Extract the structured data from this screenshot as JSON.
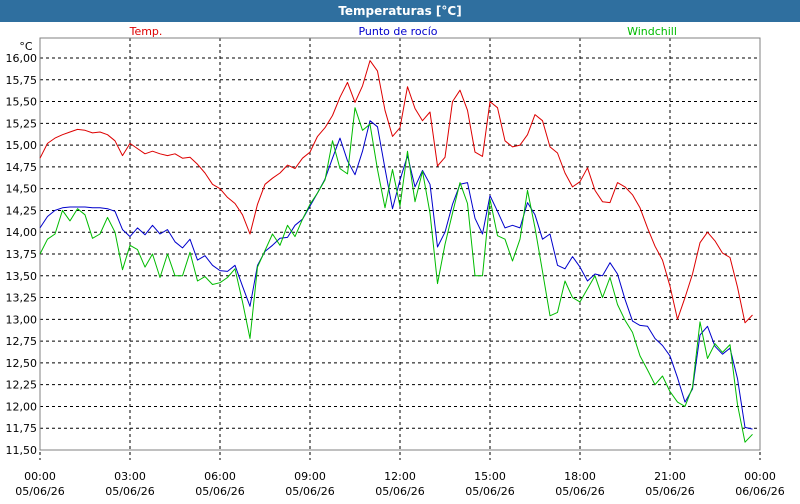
{
  "window": {
    "title": "Temperaturas [°C]"
  },
  "colors": {
    "temp": "#dd0000",
    "dew": "#0000cc",
    "wind": "#00bb00",
    "title_bg": "#2f6f9f",
    "grid": "#000000"
  },
  "chart_data": {
    "type": "line",
    "title": "Temperaturas [°C]",
    "ylabel": "°C",
    "ylim": [
      11.5,
      16.0
    ],
    "y_ticks": [
      "16,00",
      "15,75",
      "15,50",
      "15,25",
      "15,00",
      "14,75",
      "14,50",
      "14,25",
      "14,00",
      "13,75",
      "13,50",
      "13,25",
      "13,00",
      "12,75",
      "12,50",
      "12,25",
      "12,00",
      "11,75",
      "11,50"
    ],
    "y_tick_values": [
      16.0,
      15.75,
      15.5,
      15.25,
      15.0,
      14.75,
      14.5,
      14.25,
      14.0,
      13.75,
      13.5,
      13.25,
      13.0,
      12.75,
      12.5,
      12.25,
      12.0,
      11.75,
      11.5
    ],
    "x_ticks": [
      {
        "time": "00:00",
        "date": "05/06/26",
        "hour": 0
      },
      {
        "time": "03:00",
        "date": "05/06/26",
        "hour": 3
      },
      {
        "time": "06:00",
        "date": "05/06/26",
        "hour": 6
      },
      {
        "time": "09:00",
        "date": "05/06/26",
        "hour": 9
      },
      {
        "time": "12:00",
        "date": "05/06/26",
        "hour": 12
      },
      {
        "time": "15:00",
        "date": "05/06/26",
        "hour": 15
      },
      {
        "time": "18:00",
        "date": "05/06/26",
        "hour": 18
      },
      {
        "time": "21:00",
        "date": "05/06/26",
        "hour": 21
      },
      {
        "time": "00:00",
        "date": "06/06/26",
        "hour": 24
      }
    ],
    "grid": true,
    "legend_position": "top",
    "series": [
      {
        "name": "Temp.",
        "color_key": "temp",
        "points": [
          [
            0,
            14.85
          ],
          [
            0.25,
            15.02
          ],
          [
            0.5,
            15.08
          ],
          [
            0.75,
            15.12
          ],
          [
            1.0,
            15.15
          ],
          [
            1.25,
            15.18
          ],
          [
            1.5,
            15.17
          ],
          [
            1.75,
            15.14
          ],
          [
            2.0,
            15.15
          ],
          [
            2.25,
            15.12
          ],
          [
            2.5,
            15.05
          ],
          [
            2.75,
            14.88
          ],
          [
            3.0,
            15.02
          ],
          [
            3.25,
            14.96
          ],
          [
            3.5,
            14.9
          ],
          [
            3.75,
            14.93
          ],
          [
            4.0,
            14.9
          ],
          [
            4.25,
            14.88
          ],
          [
            4.5,
            14.9
          ],
          [
            4.75,
            14.85
          ],
          [
            5.0,
            14.86
          ],
          [
            5.25,
            14.78
          ],
          [
            5.5,
            14.68
          ],
          [
            5.75,
            14.55
          ],
          [
            6.0,
            14.5
          ],
          [
            6.25,
            14.4
          ],
          [
            6.5,
            14.33
          ],
          [
            6.75,
            14.2
          ],
          [
            7.0,
            13.98
          ],
          [
            7.25,
            14.32
          ],
          [
            7.5,
            14.55
          ],
          [
            7.75,
            14.62
          ],
          [
            8.0,
            14.68
          ],
          [
            8.25,
            14.77
          ],
          [
            8.5,
            14.73
          ],
          [
            8.75,
            14.85
          ],
          [
            9.0,
            14.92
          ],
          [
            9.25,
            15.1
          ],
          [
            9.5,
            15.2
          ],
          [
            9.75,
            15.34
          ],
          [
            10.0,
            15.55
          ],
          [
            10.25,
            15.72
          ],
          [
            10.5,
            15.49
          ],
          [
            10.75,
            15.68
          ],
          [
            11.0,
            15.97
          ],
          [
            11.25,
            15.85
          ],
          [
            11.5,
            15.4
          ],
          [
            11.75,
            15.1
          ],
          [
            12.0,
            15.2
          ],
          [
            12.25,
            15.67
          ],
          [
            12.5,
            15.42
          ],
          [
            12.75,
            15.28
          ],
          [
            13.0,
            15.38
          ],
          [
            13.25,
            14.76
          ],
          [
            13.5,
            14.86
          ],
          [
            13.75,
            15.5
          ],
          [
            14.0,
            15.63
          ],
          [
            14.25,
            15.4
          ],
          [
            14.5,
            14.92
          ],
          [
            14.75,
            14.87
          ],
          [
            15.0,
            15.5
          ],
          [
            15.25,
            15.43
          ],
          [
            15.5,
            15.05
          ],
          [
            15.75,
            14.98
          ],
          [
            16.0,
            15.0
          ],
          [
            16.25,
            15.12
          ],
          [
            16.5,
            15.35
          ],
          [
            16.75,
            15.28
          ],
          [
            17.0,
            14.98
          ],
          [
            17.25,
            14.91
          ],
          [
            17.5,
            14.68
          ],
          [
            17.75,
            14.52
          ],
          [
            18.0,
            14.58
          ],
          [
            18.25,
            14.74
          ],
          [
            18.5,
            14.48
          ],
          [
            18.75,
            14.35
          ],
          [
            19.0,
            14.34
          ],
          [
            19.25,
            14.57
          ],
          [
            19.5,
            14.52
          ],
          [
            19.75,
            14.43
          ],
          [
            20.0,
            14.28
          ],
          [
            20.25,
            14.05
          ],
          [
            20.5,
            13.84
          ],
          [
            20.75,
            13.68
          ],
          [
            21.0,
            13.38
          ],
          [
            21.25,
            13.0
          ],
          [
            21.5,
            13.25
          ],
          [
            21.75,
            13.52
          ],
          [
            22.0,
            13.88
          ],
          [
            22.25,
            14.0
          ],
          [
            22.5,
            13.9
          ],
          [
            22.75,
            13.76
          ],
          [
            23.0,
            13.71
          ],
          [
            23.25,
            13.37
          ],
          [
            23.5,
            12.96
          ],
          [
            23.75,
            13.05
          ]
        ]
      },
      {
        "name": "Punto de rocío",
        "color_key": "dew",
        "points": [
          [
            0,
            14.05
          ],
          [
            0.25,
            14.18
          ],
          [
            0.5,
            14.25
          ],
          [
            0.75,
            14.28
          ],
          [
            1.0,
            14.29
          ],
          [
            1.25,
            14.29
          ],
          [
            1.5,
            14.29
          ],
          [
            1.75,
            14.28
          ],
          [
            2.0,
            14.28
          ],
          [
            2.25,
            14.27
          ],
          [
            2.5,
            14.24
          ],
          [
            2.75,
            14.03
          ],
          [
            3.0,
            13.95
          ],
          [
            3.25,
            14.05
          ],
          [
            3.5,
            13.97
          ],
          [
            3.75,
            14.08
          ],
          [
            4.0,
            13.98
          ],
          [
            4.25,
            14.03
          ],
          [
            4.5,
            13.89
          ],
          [
            4.75,
            13.82
          ],
          [
            5.0,
            13.92
          ],
          [
            5.25,
            13.68
          ],
          [
            5.5,
            13.73
          ],
          [
            5.75,
            13.62
          ],
          [
            6.0,
            13.56
          ],
          [
            6.25,
            13.55
          ],
          [
            6.5,
            13.62
          ],
          [
            6.75,
            13.38
          ],
          [
            7.0,
            13.15
          ],
          [
            7.25,
            13.62
          ],
          [
            7.5,
            13.78
          ],
          [
            7.75,
            13.85
          ],
          [
            8.0,
            13.93
          ],
          [
            8.25,
            13.94
          ],
          [
            8.5,
            14.08
          ],
          [
            8.75,
            14.15
          ],
          [
            9.0,
            14.3
          ],
          [
            9.25,
            14.45
          ],
          [
            9.5,
            14.61
          ],
          [
            9.75,
            14.85
          ],
          [
            10.0,
            15.08
          ],
          [
            10.25,
            14.82
          ],
          [
            10.5,
            14.66
          ],
          [
            10.75,
            14.93
          ],
          [
            11.0,
            15.28
          ],
          [
            11.25,
            15.21
          ],
          [
            11.5,
            14.73
          ],
          [
            11.75,
            14.27
          ],
          [
            12.0,
            14.6
          ],
          [
            12.25,
            14.88
          ],
          [
            12.5,
            14.52
          ],
          [
            12.75,
            14.71
          ],
          [
            13.0,
            14.55
          ],
          [
            13.25,
            13.83
          ],
          [
            13.5,
            14.0
          ],
          [
            13.75,
            14.32
          ],
          [
            14.0,
            14.55
          ],
          [
            14.25,
            14.57
          ],
          [
            14.5,
            14.16
          ],
          [
            14.75,
            13.98
          ],
          [
            15.0,
            14.42
          ],
          [
            15.25,
            14.24
          ],
          [
            15.5,
            14.05
          ],
          [
            15.75,
            14.08
          ],
          [
            16.0,
            14.05
          ],
          [
            16.25,
            14.34
          ],
          [
            16.5,
            14.2
          ],
          [
            16.75,
            13.92
          ],
          [
            17.0,
            13.98
          ],
          [
            17.25,
            13.62
          ],
          [
            17.5,
            13.58
          ],
          [
            17.75,
            13.72
          ],
          [
            18.0,
            13.6
          ],
          [
            18.25,
            13.44
          ],
          [
            18.5,
            13.52
          ],
          [
            18.75,
            13.5
          ],
          [
            19.0,
            13.65
          ],
          [
            19.25,
            13.52
          ],
          [
            19.5,
            13.23
          ],
          [
            19.75,
            12.98
          ],
          [
            20.0,
            12.93
          ],
          [
            20.25,
            12.92
          ],
          [
            20.5,
            12.78
          ],
          [
            20.75,
            12.7
          ],
          [
            21.0,
            12.58
          ],
          [
            21.25,
            12.33
          ],
          [
            21.5,
            12.05
          ],
          [
            21.75,
            12.2
          ],
          [
            22.0,
            12.82
          ],
          [
            22.25,
            12.92
          ],
          [
            22.5,
            12.69
          ],
          [
            22.75,
            12.6
          ],
          [
            23.0,
            12.67
          ],
          [
            23.25,
            12.32
          ],
          [
            23.5,
            11.76
          ],
          [
            23.75,
            11.74
          ]
        ]
      },
      {
        "name": "Windchill",
        "color_key": "wind",
        "points": [
          [
            0,
            13.75
          ],
          [
            0.25,
            13.92
          ],
          [
            0.5,
            13.98
          ],
          [
            0.75,
            14.25
          ],
          [
            1.0,
            14.13
          ],
          [
            1.25,
            14.27
          ],
          [
            1.5,
            14.2
          ],
          [
            1.75,
            13.93
          ],
          [
            2.0,
            13.98
          ],
          [
            2.25,
            14.17
          ],
          [
            2.5,
            14.0
          ],
          [
            2.75,
            13.57
          ],
          [
            3.0,
            13.85
          ],
          [
            3.25,
            13.8
          ],
          [
            3.5,
            13.6
          ],
          [
            3.75,
            13.75
          ],
          [
            4.0,
            13.48
          ],
          [
            4.25,
            13.75
          ],
          [
            4.5,
            13.5
          ],
          [
            4.75,
            13.5
          ],
          [
            5.0,
            13.77
          ],
          [
            5.25,
            13.44
          ],
          [
            5.5,
            13.49
          ],
          [
            5.75,
            13.4
          ],
          [
            6.0,
            13.42
          ],
          [
            6.25,
            13.48
          ],
          [
            6.5,
            13.58
          ],
          [
            6.75,
            13.2
          ],
          [
            7.0,
            12.78
          ],
          [
            7.25,
            13.6
          ],
          [
            7.75,
            13.98
          ],
          [
            8.0,
            13.85
          ],
          [
            8.25,
            14.08
          ],
          [
            8.5,
            13.95
          ],
          [
            8.75,
            14.15
          ],
          [
            9.0,
            14.32
          ],
          [
            9.25,
            14.45
          ],
          [
            9.5,
            14.6
          ],
          [
            9.75,
            15.05
          ],
          [
            10.0,
            14.73
          ],
          [
            10.25,
            14.67
          ],
          [
            10.5,
            15.43
          ],
          [
            10.75,
            15.17
          ],
          [
            11.0,
            15.24
          ],
          [
            11.25,
            14.72
          ],
          [
            11.5,
            14.28
          ],
          [
            11.75,
            14.72
          ],
          [
            12.0,
            14.3
          ],
          [
            12.25,
            14.93
          ],
          [
            12.5,
            14.35
          ],
          [
            12.75,
            14.7
          ],
          [
            13.0,
            14.22
          ],
          [
            13.25,
            13.41
          ],
          [
            13.5,
            13.86
          ],
          [
            13.75,
            14.22
          ],
          [
            14.0,
            14.57
          ],
          [
            14.25,
            14.33
          ],
          [
            14.5,
            13.5
          ],
          [
            14.75,
            13.5
          ],
          [
            15.0,
            14.38
          ],
          [
            15.25,
            13.96
          ],
          [
            15.5,
            13.92
          ],
          [
            15.75,
            13.67
          ],
          [
            16.0,
            13.92
          ],
          [
            16.25,
            14.48
          ],
          [
            16.5,
            14.05
          ],
          [
            16.75,
            13.55
          ],
          [
            17.0,
            13.04
          ],
          [
            17.25,
            13.08
          ],
          [
            17.5,
            13.44
          ],
          [
            17.75,
            13.25
          ],
          [
            18.0,
            13.2
          ],
          [
            18.25,
            13.35
          ],
          [
            18.5,
            13.5
          ],
          [
            18.75,
            13.25
          ],
          [
            19.0,
            13.48
          ],
          [
            19.25,
            13.17
          ],
          [
            19.5,
            12.99
          ],
          [
            19.75,
            12.85
          ],
          [
            20.0,
            12.58
          ],
          [
            20.25,
            12.42
          ],
          [
            20.5,
            12.25
          ],
          [
            20.75,
            12.35
          ],
          [
            21.0,
            12.17
          ],
          [
            21.25,
            12.05
          ],
          [
            21.5,
            12.0
          ],
          [
            21.75,
            12.22
          ],
          [
            22.0,
            12.97
          ],
          [
            22.25,
            12.55
          ],
          [
            22.5,
            12.72
          ],
          [
            22.75,
            12.62
          ],
          [
            23.0,
            12.71
          ],
          [
            23.25,
            12.02
          ],
          [
            23.5,
            11.59
          ],
          [
            23.75,
            11.68
          ]
        ]
      }
    ]
  }
}
